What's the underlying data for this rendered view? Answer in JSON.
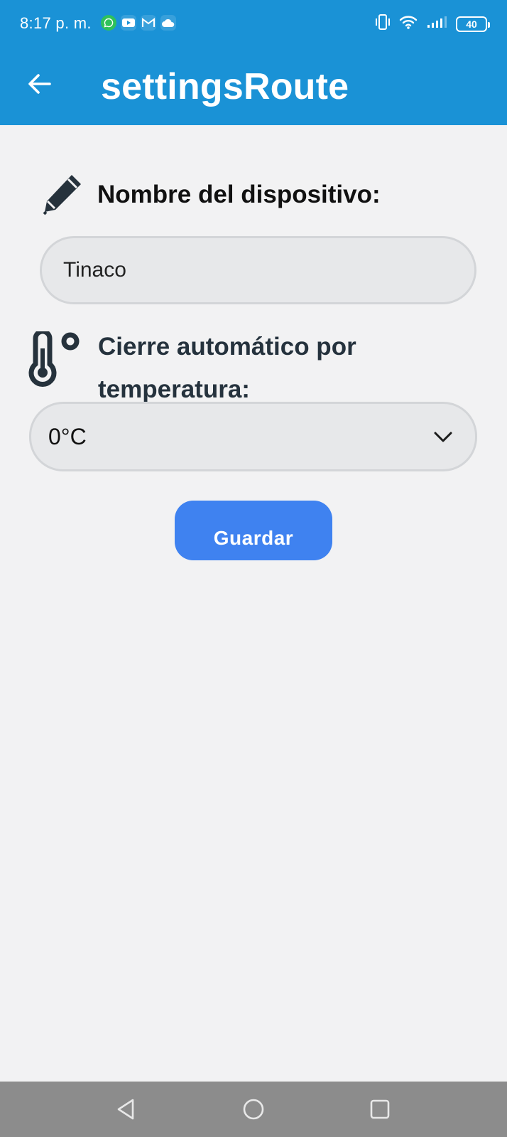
{
  "status_bar": {
    "time": "8:17 p. m.",
    "notification_icons": [
      "whatsapp-icon",
      "youtube-icon",
      "gmail-icon",
      "cloud-icon"
    ],
    "system_icons": [
      "vibrate-icon",
      "wifi-icon",
      "signal-icon",
      "battery-icon"
    ],
    "battery_level": "40"
  },
  "app_bar": {
    "title": "settingsRoute",
    "back_icon": "arrow-left-icon",
    "color": "#1a92d6"
  },
  "device_name": {
    "label": "Nombre del dispositivo:",
    "icon": "pencil-icon",
    "value": "Tinaco"
  },
  "temperature": {
    "label": "Cierre automático por temperatura:",
    "icon": "thermometer-icon",
    "selected": "0°C"
  },
  "actions": {
    "save_label": "Guardar",
    "save_color": "#3f82f0"
  },
  "nav_bar": {
    "buttons": [
      "back-triangle-icon",
      "home-circle-icon",
      "recents-square-icon"
    ]
  }
}
